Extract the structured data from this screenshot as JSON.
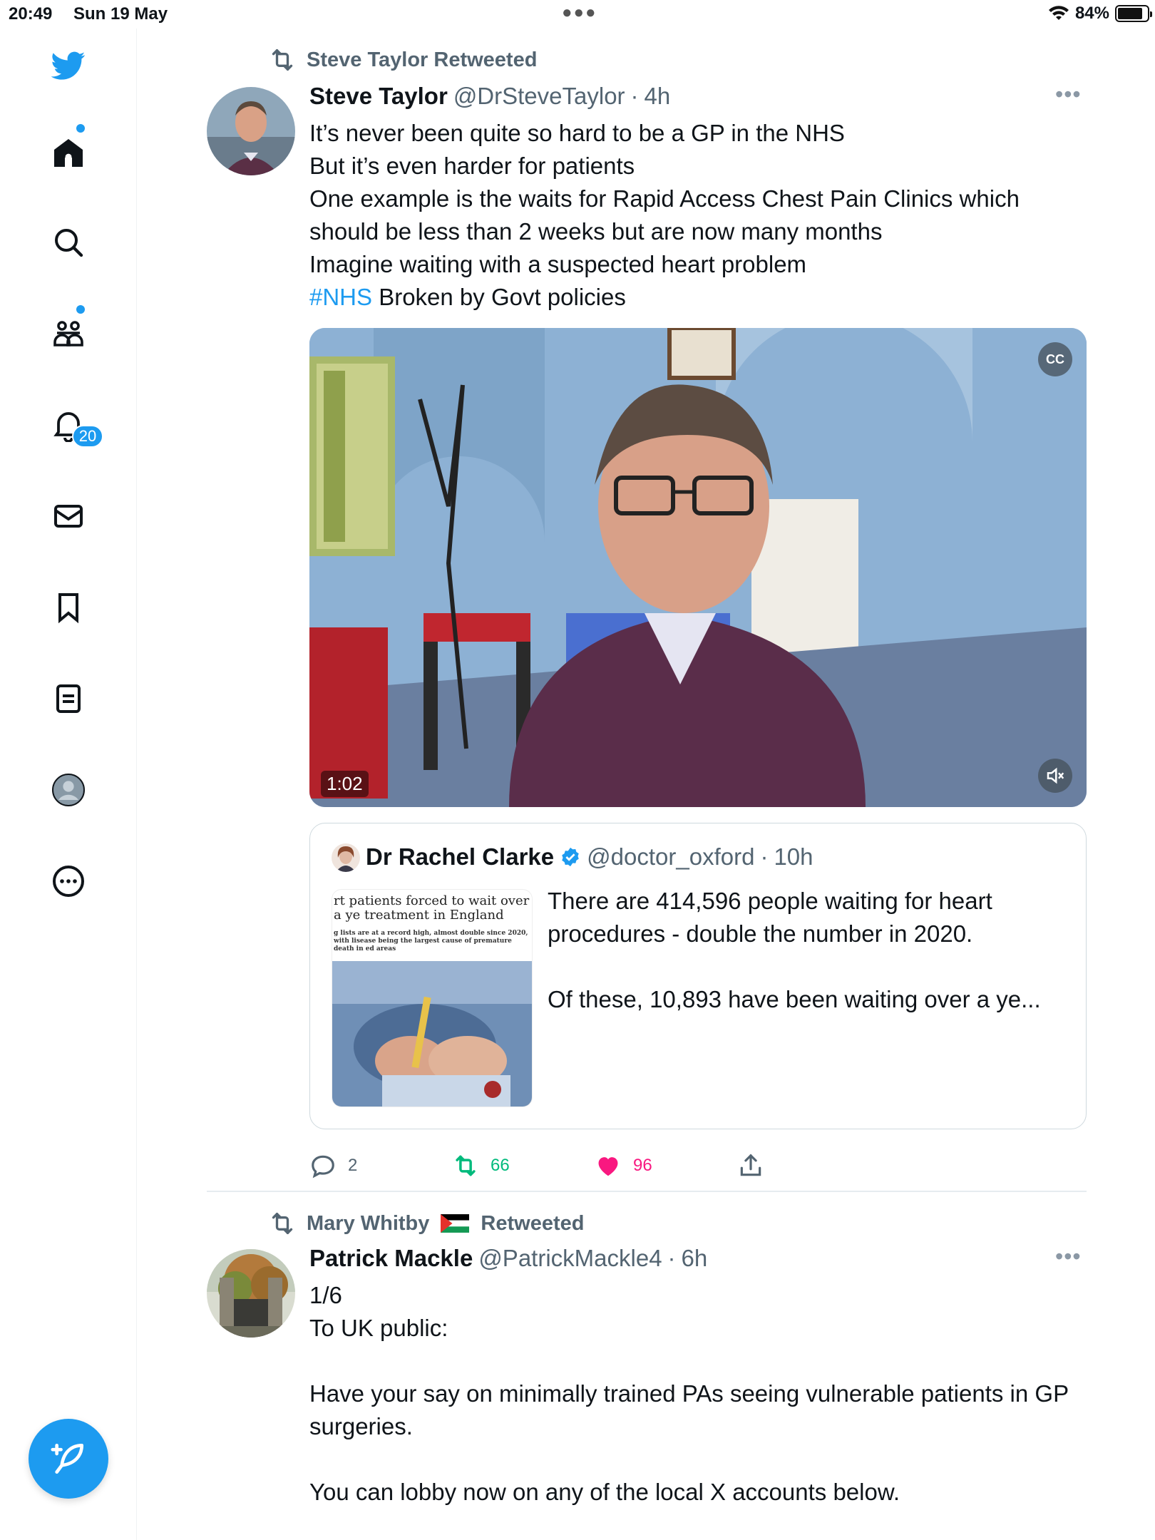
{
  "status_bar": {
    "time": "20:49",
    "date": "Sun 19 May",
    "battery": "84%",
    "battery_level": 0.84
  },
  "sidebar": {
    "notifications_badge": "20",
    "items": [
      {
        "name": "home",
        "icon": "home-icon"
      },
      {
        "name": "explore",
        "icon": "search-icon"
      },
      {
        "name": "communities",
        "icon": "communities-icon"
      },
      {
        "name": "notifications",
        "icon": "bell-icon"
      },
      {
        "name": "messages",
        "icon": "mail-icon"
      },
      {
        "name": "bookmarks",
        "icon": "bookmark-icon"
      },
      {
        "name": "lists",
        "icon": "list-icon"
      },
      {
        "name": "profile",
        "icon": "profile-icon"
      },
      {
        "name": "more",
        "icon": "more-circle-icon"
      }
    ],
    "compose_icon": "compose-feather-icon"
  },
  "tweets": [
    {
      "retweeted_by": "Steve Taylor Retweeted",
      "name": "Steve Taylor",
      "handle": "@DrSteveTaylor",
      "separator": "·",
      "time": "4h",
      "lines": [
        "It’s never been quite so hard to be a GP in the NHS",
        "But it’s even harder for patients",
        "One example is the waits for Rapid Access Chest Pain Clinics which",
        "should be less than 2 weeks but are now many months",
        "Imagine waiting with a suspected heart problem"
      ],
      "hashtag": "#NHS",
      "last_line": " Broken by Govt policies",
      "video": {
        "duration": "1:02",
        "cc_label": "CC"
      },
      "quote": {
        "name": "Dr Rachel Clarke",
        "handle": "@doctor_oxford",
        "separator": "·",
        "time": "10h",
        "thumb_headline": "rt patients forced to wait over a ye treatment in England",
        "thumb_sub": "g lists are at a record high, almost double since 2020, with lisease being the largest cause of premature death in ed areas",
        "lines": [
          "There are 414,596 people waiting for heart",
          "procedures - double the number in 2020.",
          "",
          "Of these, 10,893 have been waiting over a ye..."
        ]
      },
      "actions": {
        "replies": "2",
        "retweets": "66",
        "likes": "96"
      }
    },
    {
      "retweeted_by_name": "Mary Whitby",
      "retweeted_suffix": "Retweeted",
      "name": "Patrick Mackle",
      "handle": "@PatrickMackle4",
      "separator": "·",
      "time": "6h",
      "lines": [
        "1/6",
        "To UK public:",
        "",
        "Have your say on minimally trained PAs seeing vulnerable patients in GP",
        "surgeries.",
        "",
        "You can lobby now on any of the local X accounts below."
      ]
    }
  ],
  "colors": {
    "accent": "#1d9bf0",
    "retweet_green": "#00ba7c",
    "like_pink": "#f91880",
    "secondary_text": "#536471"
  }
}
